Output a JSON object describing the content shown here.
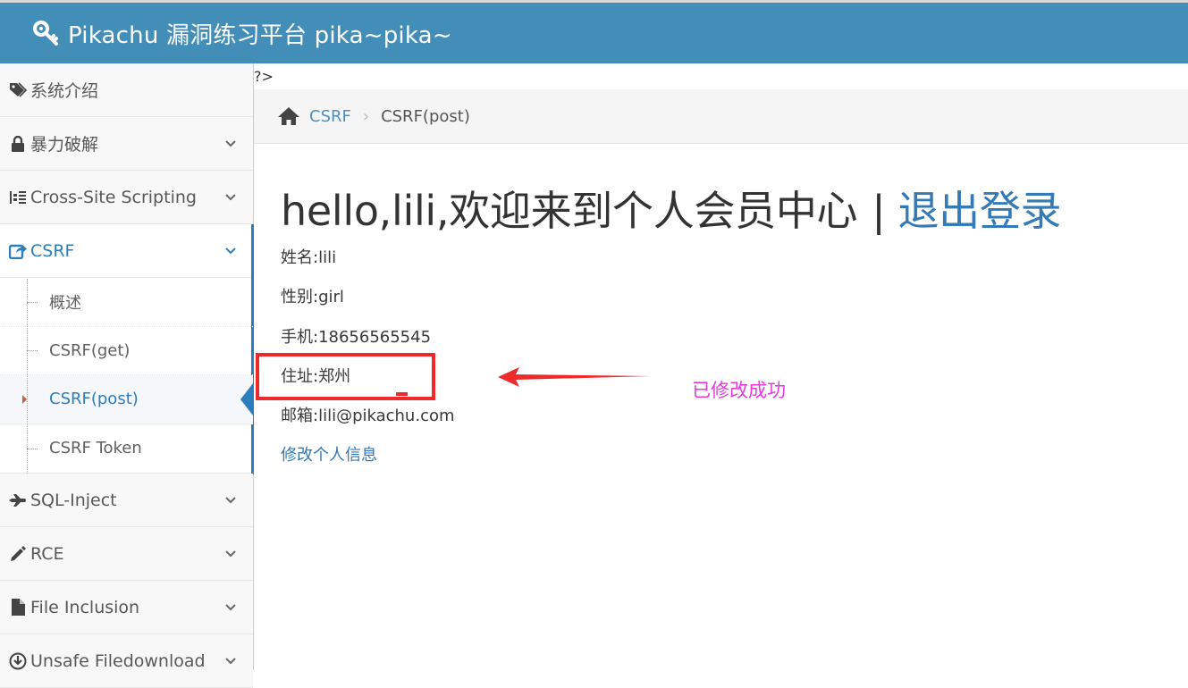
{
  "header": {
    "brand": "Pikachu 漏洞练习平台 pika~pika~",
    "icon": "key-icon",
    "color": "#438eb9"
  },
  "sidebar": {
    "items": [
      {
        "label": "系统介绍",
        "icon": "tags-icon"
      },
      {
        "label": "暴力破解",
        "icon": "lock-icon"
      },
      {
        "label": "Cross-Site Scripting",
        "icon": "list-indent-icon"
      },
      {
        "label": "CSRF",
        "icon": "share-icon"
      },
      {
        "label": "SQL-Inject",
        "icon": "plane-icon"
      },
      {
        "label": "RCE",
        "icon": "pencil-icon"
      },
      {
        "label": "File Inclusion",
        "icon": "file-icon"
      },
      {
        "label": "Unsafe Filedownload",
        "icon": "download-icon"
      }
    ],
    "csrf_sub": [
      "概述",
      "CSRF(get)",
      "CSRF(post)",
      "CSRF Token"
    ],
    "active_color": "#2b7dbc"
  },
  "main": {
    "php_tag": "?>",
    "breadcrumb": {
      "link": "CSRF",
      "current": "CSRF(post)"
    },
    "welcome": {
      "text": "hello,lili,欢迎来到个人会员中心",
      "divider": "|",
      "logout": "退出登录"
    },
    "profile": {
      "name": "姓名:lili",
      "gender": "性别:girl",
      "phone": "手机:18656565545",
      "address": "住址:郑州",
      "email": "邮箱:lili@pikachu.com"
    },
    "edit_link": "修改个人信息"
  },
  "annotation": {
    "text": "已修改成功",
    "box_color": "#ee2a2a",
    "text_color": "#e63bd9"
  }
}
